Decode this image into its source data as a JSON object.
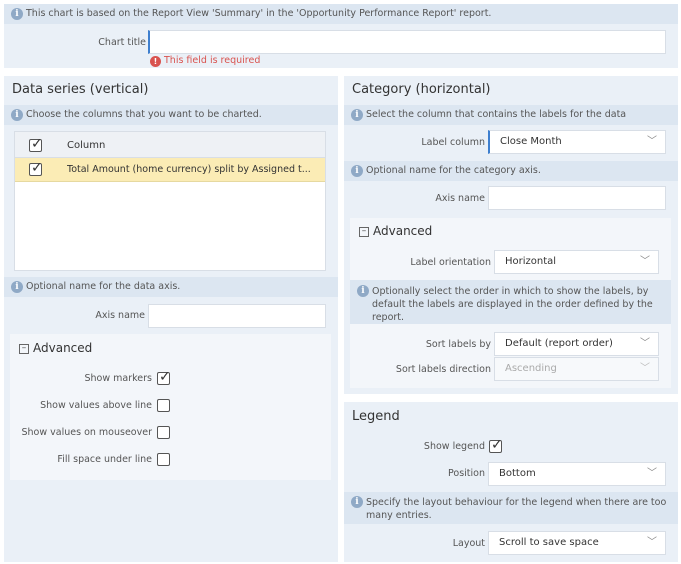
{
  "top": {
    "info_text": "This chart is based on the Report View 'Summary' in the 'Opportunity Performance Report' report.",
    "chart_title_label": "Chart title",
    "chart_title_value": "",
    "error_text": "This field is required"
  },
  "data_series": {
    "title": "Data series (vertical)",
    "info_text": "Choose the columns that you want to be charted.",
    "table": {
      "header": "Column",
      "rows": [
        {
          "label": "Total Amount (home currency) split by Assigned t...",
          "checked": true
        }
      ]
    },
    "axis_info": "Optional name for the data axis.",
    "axis_name_label": "Axis name",
    "axis_name_value": "",
    "advanced": {
      "title": "Advanced",
      "options": [
        {
          "label": "Show markers",
          "checked": true
        },
        {
          "label": "Show values above line",
          "checked": false
        },
        {
          "label": "Show values on mouseover",
          "checked": false
        },
        {
          "label": "Fill space under line",
          "checked": false
        }
      ]
    }
  },
  "category": {
    "title": "Category (horizontal)",
    "info_text": "Select the column that contains the labels for the data",
    "label_column_label": "Label column",
    "label_column_value": "Close Month",
    "axis_info": "Optional name for the category axis.",
    "axis_name_label": "Axis name",
    "axis_name_value": "",
    "advanced": {
      "title": "Advanced",
      "label_orientation_label": "Label orientation",
      "label_orientation_value": "Horizontal",
      "sort_info": "Optionally select the order in which to show the labels, by default the labels are displayed in the order defined by the report.",
      "sort_by_label": "Sort labels by",
      "sort_by_value": "Default (report order)",
      "sort_dir_label": "Sort labels direction",
      "sort_dir_value": "Ascending"
    }
  },
  "legend": {
    "title": "Legend",
    "show_legend_label": "Show legend",
    "show_legend_checked": true,
    "position_label": "Position",
    "position_value": "Bottom",
    "layout_info": "Specify the layout behaviour for the legend when there are too many entries.",
    "layout_label": "Layout",
    "layout_value": "Scroll to save space"
  },
  "colors": {
    "panel_bg": "#eaf0f7",
    "info_bg": "#dce6f1",
    "accent": "#3e7fcf",
    "error": "#d9534f",
    "selected_row": "#fbecb5"
  }
}
